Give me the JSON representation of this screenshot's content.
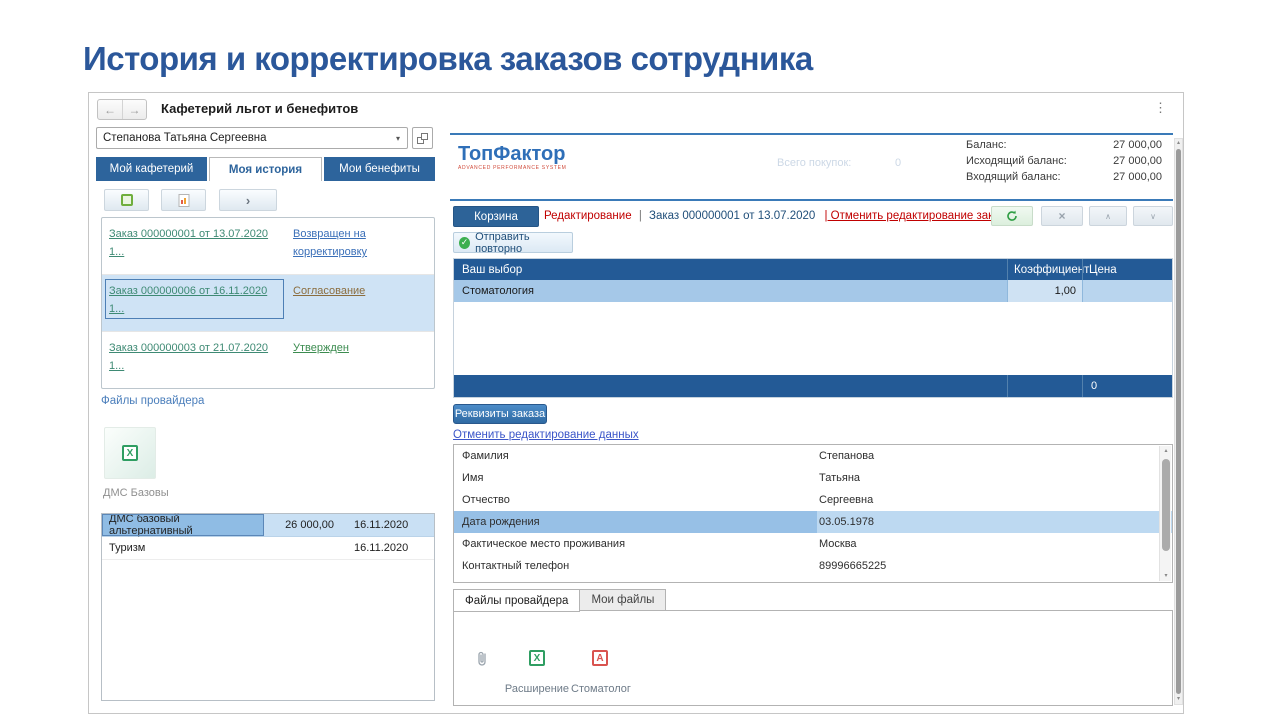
{
  "page": {
    "title": "История и корректировка заказов сотрудника"
  },
  "window": {
    "title": "Кафетерий льгот и бенефитов",
    "back_icon": "←",
    "forward_icon": "→",
    "menu_icon": "⋮"
  },
  "left_panel": {
    "employee_select": {
      "value": "Степанова Татьяна Сергеевна",
      "dropdown_icon": "▾"
    },
    "tabs": [
      {
        "label": "Мой кафетерий"
      },
      {
        "label": "Моя история"
      },
      {
        "label": "Мои бенефиты"
      }
    ],
    "toolbar": {
      "more_icon": "›"
    },
    "orders": [
      {
        "title": "Заказ 000000001 от 13.07.2020 1...",
        "status": "Возвращен на корректировку"
      },
      {
        "title": "Заказ 000000006 от 16.11.2020 1...",
        "status": "Согласование"
      },
      {
        "title": "Заказ 000000003 от 21.07.2020 1...",
        "status": "Утвержден"
      }
    ],
    "provider_files_label": "Файлы провайдера",
    "file_tile": {
      "label": "ДМС Базовы",
      "excel_glyph": "X"
    },
    "benefits_rows": [
      {
        "name": "ДМС базовый альтернативный",
        "amount": "26 000,00",
        "date": "16.11.2020"
      },
      {
        "name": "Туризм",
        "amount": "",
        "date": "16.11.2020"
      }
    ]
  },
  "right_panel": {
    "logo": {
      "title": "ТопФактор",
      "subtitle": "ADVANCED PERFORMANCE SYSTEM"
    },
    "purchases_watermark": {
      "label": "Всего покупок:",
      "value": "0"
    },
    "balance": {
      "rows": [
        {
          "label": "Баланс:",
          "value": "27 000,00"
        },
        {
          "label": "Исходящий баланс:",
          "value": "27 000,00"
        },
        {
          "label": "Входящий баланс:",
          "value": "27 000,00"
        }
      ]
    },
    "cart_button": "Корзина",
    "edit_bar": {
      "mode": "Редактирование",
      "separator": "|",
      "order": "Заказ 000000001 от 13.07.2020",
      "cancel_link": "| Отменить редактирование заказа",
      "close_icon": "×",
      "up_icon": "∧",
      "down_icon": "∨"
    },
    "resend_button": {
      "label": "Отправить повторно",
      "check_icon": "✓"
    },
    "order_table": {
      "headers": {
        "choice": "Ваш выбор",
        "coefficient": "Коэффициент",
        "price": "Цена"
      },
      "rows": [
        {
          "name": "Стоматология",
          "coefficient": "1,00",
          "price": ""
        }
      ],
      "total_price": "0"
    },
    "details_button": "Реквизиты заказа",
    "cancel_data_link": "Отменить редактирование данных",
    "person_fields": [
      {
        "label": "Фамилия",
        "value": "Степанова"
      },
      {
        "label": "Имя",
        "value": "Татьяна"
      },
      {
        "label": "Отчество",
        "value": "Сергеевна"
      },
      {
        "label": "Дата рождения",
        "value": "03.05.1978"
      },
      {
        "label": "Фактическое место проживания",
        "value": "Москва"
      },
      {
        "label": "Контактный телефон",
        "value": "89996665225"
      }
    ],
    "file_tabs": [
      {
        "label": "Файлы провайдера"
      },
      {
        "label": "Мои файлы"
      }
    ],
    "file_tiles": [
      {
        "label": "",
        "type": "attachment"
      },
      {
        "label": "Расширение",
        "type": "excel",
        "glyph": "X"
      },
      {
        "label": "Стоматолог",
        "type": "pdf",
        "glyph": "A"
      }
    ]
  },
  "colors": {
    "title_blue": "#2b579a",
    "accent_blue": "#2d649c",
    "table_header_blue": "#235a96",
    "selection_blue": "#aecdeb",
    "edit_red": "#c00000",
    "order_link_teal": "#3e8a74",
    "status_returned_blue": "#3a6fb8",
    "status_approval_brown": "#8b6d3e",
    "status_approved_green": "#3c8c50",
    "hyperlink_blue": "#3a55c8",
    "logo_blue": "#2f6fb8",
    "logo_red": "#d04a3a"
  }
}
